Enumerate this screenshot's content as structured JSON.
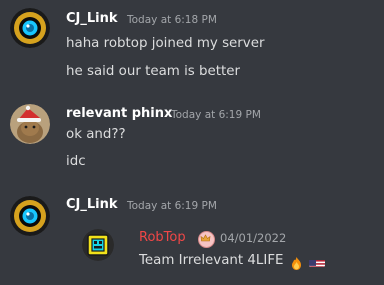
{
  "messages": [
    {
      "username": "CJ_Link",
      "timestamp": "Today at 6:18 PM",
      "lines": [
        "haha robtop joined my server",
        "he said our team is better"
      ]
    },
    {
      "username": "relevant phinx",
      "timestamp": "Today at 6:19 PM",
      "lines": [
        "ok and??",
        "idc"
      ]
    },
    {
      "username": "CJ_Link",
      "timestamp": "Today at 6:19 PM",
      "embed": {
        "author": "RobTop",
        "date": "04/01/2022",
        "text": "Team Irrelevant 4LIFE"
      }
    }
  ],
  "icons": {
    "avatar_1": "gd-eye-avatar",
    "avatar_2": "cat-santa-hat-avatar",
    "avatar_3": "gd-eye-avatar",
    "embed_avatar": "gd-cube-avatar",
    "crown_badge": "crown-icon",
    "emoji_1": "fire-emoji",
    "emoji_2": "us-flag-emoji"
  },
  "colors": {
    "background": "#36393f",
    "username": "#ffffff",
    "text": "#dcddde",
    "muted": "#a3a6aa",
    "embed_author": "#f04747"
  }
}
